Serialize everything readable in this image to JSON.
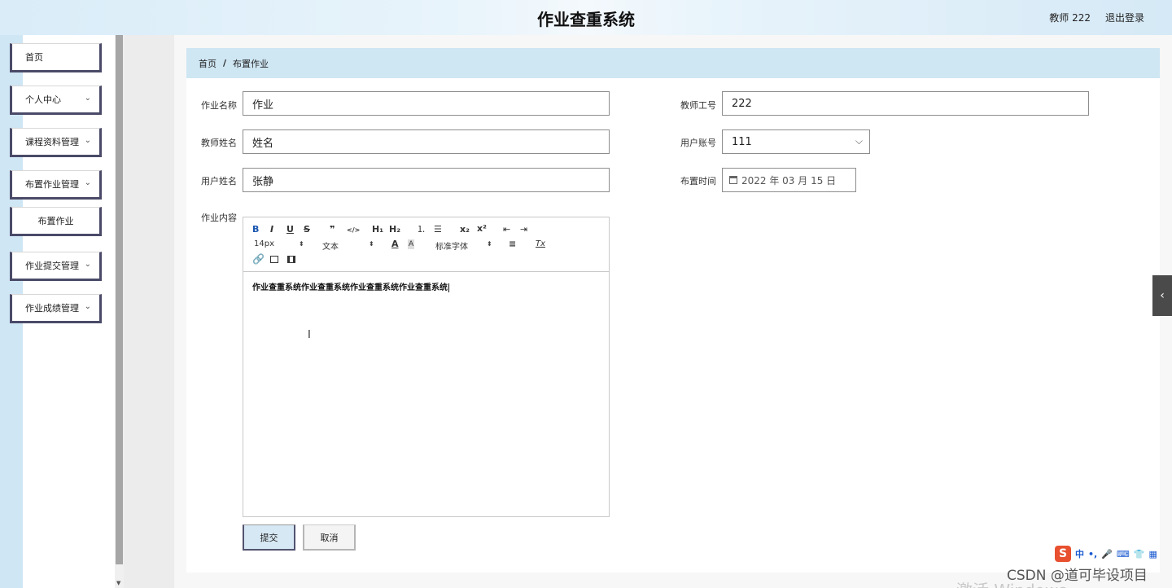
{
  "header": {
    "title": "作业查重系统",
    "user": "教师 222",
    "logout": "退出登录"
  },
  "sidebar": {
    "items": [
      {
        "label": "首页",
        "has_chevron": false
      },
      {
        "label": "个人中心",
        "has_chevron": true
      },
      {
        "label": "课程资料管理",
        "has_chevron": true
      },
      {
        "label": "布置作业管理",
        "has_chevron": true
      },
      {
        "label": "布置作业",
        "has_chevron": false,
        "sub": true
      },
      {
        "label": "作业提交管理",
        "has_chevron": true
      },
      {
        "label": "作业成绩管理",
        "has_chevron": true
      }
    ],
    "chevron": "⌄"
  },
  "breadcrumb": {
    "home": "首页",
    "sep": "/",
    "current": "布置作业"
  },
  "form": {
    "homework_name_label": "作业名称",
    "homework_name_value": "作业",
    "teacher_id_label": "教师工号",
    "teacher_id_value": "222",
    "teacher_name_label": "教师姓名",
    "teacher_name_value": "姓名",
    "user_account_label": "用户账号",
    "user_account_value": "111",
    "user_name_label": "用户姓名",
    "user_name_value": "张静",
    "assign_time_label": "布置时间",
    "assign_time_value": "2022 年 03 月 15 日",
    "content_label": "作业内容"
  },
  "editor": {
    "toolbar": {
      "bold": "B",
      "italic": "I",
      "underline": "U",
      "strike": "S",
      "quote": "❞",
      "code": "</>",
      "h1": "H₁",
      "h2": "H₂",
      "ordered_list": "⒈",
      "bullet_list": "☰",
      "subscript": "x₂",
      "superscript": "x²",
      "outdent": "⇤",
      "indent": "⇥",
      "font_size": "14px",
      "text_style": "文本",
      "font_family": "标准字体",
      "font_color": "A",
      "bg_color": "A",
      "align": "≡",
      "clear": "Tx",
      "link_icon": "link-icon",
      "image_icon": "image-icon",
      "video_icon": "video-icon"
    },
    "content": "作业查重系统作业查重系统作业查重系统作业查重系统"
  },
  "buttons": {
    "submit": "提交",
    "cancel": "取消"
  },
  "overlay": {
    "watermark": "CSDN @道可毕设项目",
    "activate": "激活 Windows",
    "ime": "中"
  },
  "colors": {
    "header_bg": "#d9ecf8",
    "breadcrumb_bg": "#cfe6f3",
    "menu_border": "#4a4a68",
    "submit_bg": "#d6e8f4"
  }
}
